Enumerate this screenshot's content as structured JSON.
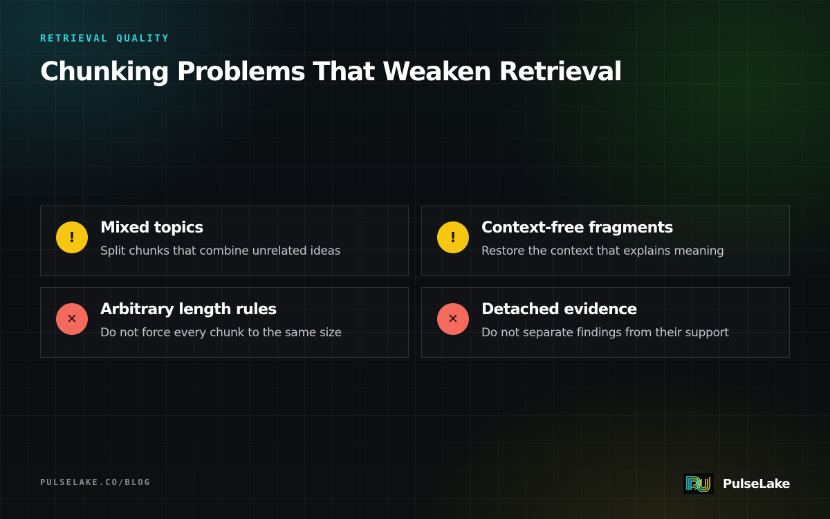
{
  "header": {
    "eyebrow": "RETRIEVAL QUALITY",
    "title": "Chunking Problems That Weaken Retrieval"
  },
  "cards": [
    {
      "status": "warning",
      "icon": "exclamation-icon",
      "glyph": "!",
      "title": "Mixed topics",
      "description": "Split chunks that combine unrelated ideas"
    },
    {
      "status": "warning",
      "icon": "exclamation-icon",
      "glyph": "!",
      "title": "Context-free fragments",
      "description": "Restore the context that explains meaning"
    },
    {
      "status": "error",
      "icon": "cross-icon",
      "glyph": "✕",
      "title": "Arbitrary length rules",
      "description": "Do not force every chunk to the same size"
    },
    {
      "status": "error",
      "icon": "cross-icon",
      "glyph": "✕",
      "title": "Detached evidence",
      "description": "Do not separate findings from their support"
    }
  ],
  "footer": {
    "url": "PULSELAKE.CO/BLOG",
    "brand": "PulseLake",
    "logo_icon": "pulselake-logo-icon"
  },
  "colors": {
    "accent": "#2fd3dc",
    "warning": "#f6c611",
    "error": "#f46a5c"
  }
}
